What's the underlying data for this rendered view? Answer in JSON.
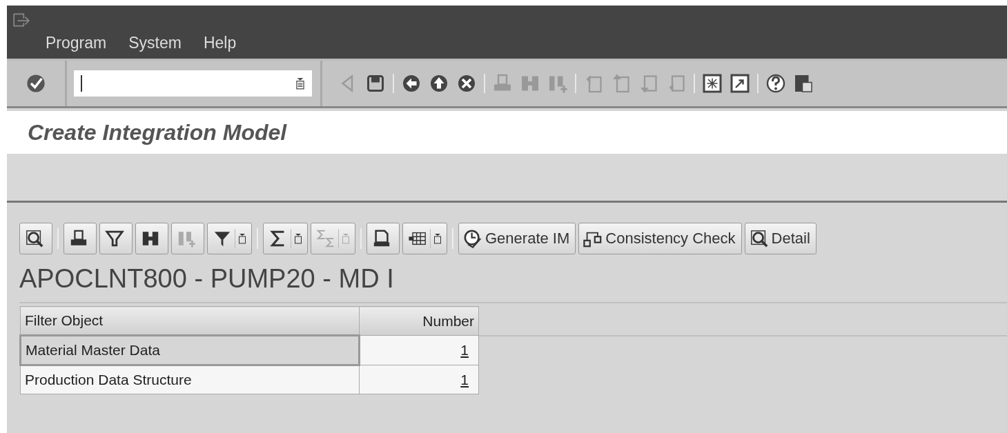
{
  "menu": [
    {
      "label": "Program"
    },
    {
      "label": "System"
    },
    {
      "label": "Help"
    }
  ],
  "standard_toolbar": {
    "groups": [
      [
        {
          "disabled": true
        },
        {
          "disabled": false
        }
      ],
      [
        {
          "disabled": false
        },
        {
          "disabled": false
        },
        {
          "disabled": false
        }
      ],
      [
        {
          "disabled": true
        },
        {
          "disabled": true
        },
        {
          "disabled": true
        }
      ],
      [
        {
          "disabled": true
        },
        {
          "disabled": true
        },
        {
          "disabled": true
        },
        {
          "disabled": true
        }
      ],
      [
        {
          "disabled": false
        },
        {
          "disabled": false
        }
      ],
      [
        {
          "disabled": false
        },
        {
          "disabled": false
        }
      ]
    ]
  },
  "screen_title": "Create Integration Model",
  "alv_toolbar": {
    "groups": [
      [
        {
          "kind": "icon",
          "disabled": false
        }
      ],
      [
        {
          "kind": "icon",
          "disabled": false
        },
        {
          "kind": "icon",
          "disabled": false
        },
        {
          "kind": "icon",
          "disabled": false
        },
        {
          "kind": "icon",
          "disabled": true
        },
        {
          "kind": "dropdown",
          "disabled": false
        }
      ],
      [
        {
          "kind": "dropdown",
          "disabled": false
        },
        {
          "kind": "dropdown",
          "disabled": true
        }
      ],
      [
        {
          "kind": "icon",
          "disabled": false
        },
        {
          "kind": "dropdown",
          "disabled": false
        }
      ],
      [
        {
          "kind": "text",
          "label": "Generate IM",
          "disabled": false
        },
        {
          "kind": "text",
          "label": "Consistency Check",
          "disabled": false
        },
        {
          "kind": "text",
          "label": "Detail",
          "disabled": false
        }
      ]
    ]
  },
  "list_title": "APOCLNT800 - PUMP20 - MD I",
  "table": {
    "columns": [
      "Filter Object",
      "Number"
    ],
    "rows": [
      {
        "filter_object": "Material Master Data",
        "number": "1",
        "selected": true
      },
      {
        "filter_object": "Production Data Structure",
        "number": "1",
        "selected": false
      }
    ]
  }
}
